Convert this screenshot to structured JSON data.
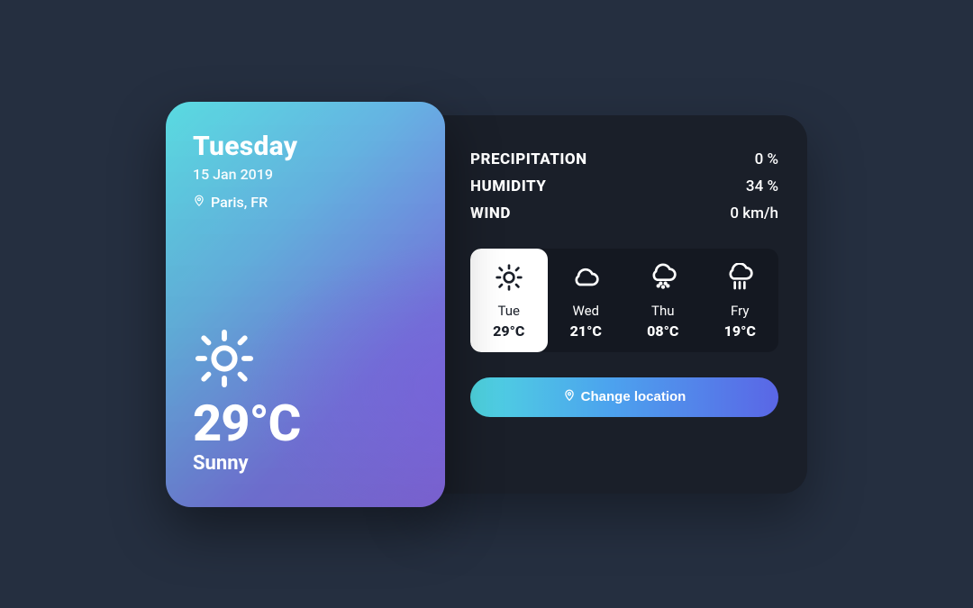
{
  "current": {
    "day": "Tuesday",
    "date": "15 Jan 2019",
    "location": "Paris, FR",
    "temp": "29°C",
    "condition": "Sunny",
    "icon": "sun-icon"
  },
  "stats": {
    "precipitation": {
      "label": "PRECIPITATION",
      "value": "0 %"
    },
    "humidity": {
      "label": "HUMIDITY",
      "value": "34 %"
    },
    "wind": {
      "label": "WIND",
      "value": "0 km/h"
    }
  },
  "forecast": [
    {
      "day": "Tue",
      "temp": "29°C",
      "icon": "sun-icon",
      "active": true
    },
    {
      "day": "Wed",
      "temp": "21°C",
      "icon": "cloud-icon",
      "active": false
    },
    {
      "day": "Thu",
      "temp": "08°C",
      "icon": "snow-icon",
      "active": false
    },
    {
      "day": "Fry",
      "temp": "19°C",
      "icon": "rain-icon",
      "active": false
    }
  ],
  "button": {
    "label": "Change location"
  }
}
